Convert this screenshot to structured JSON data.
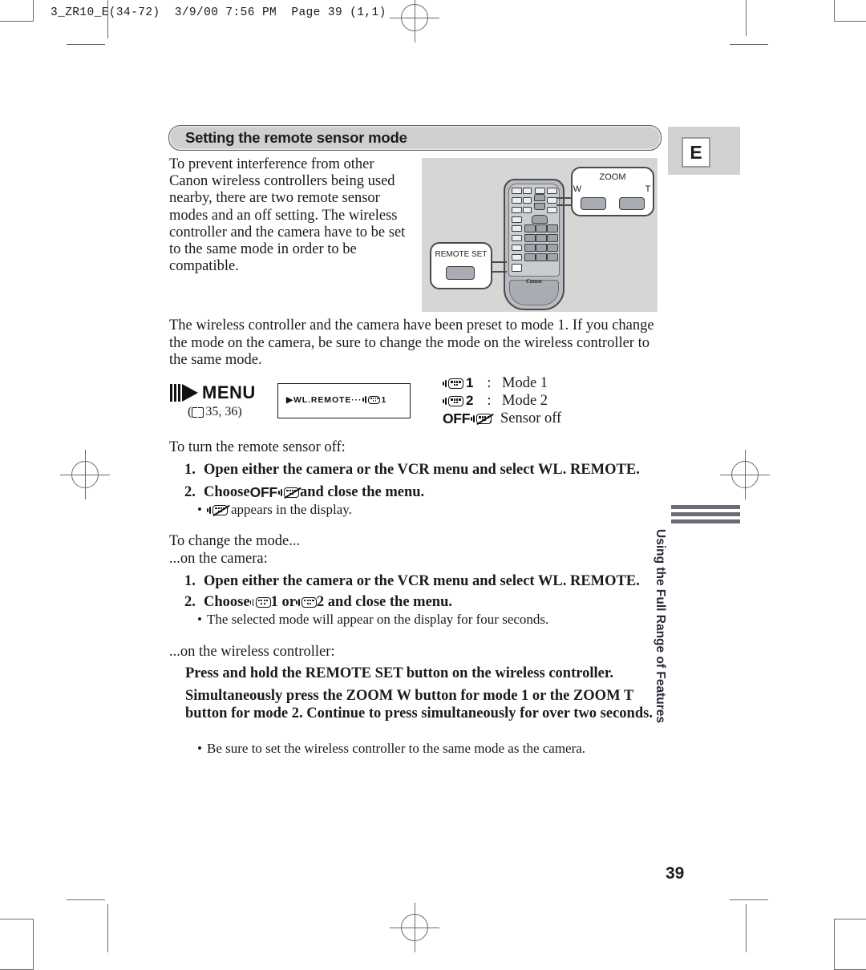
{
  "page": {
    "slug": "3_ZR10_E(34-72)  3/9/00 7:56 PM  Page 39 (1,1)",
    "number": "39",
    "lang_tab": "E"
  },
  "section": {
    "title": "Setting the remote sensor mode"
  },
  "intro": {
    "text": "To prevent interference from other Canon wireless controllers being used nearby, there are two remote sensor modes and an off setting. The wireless controller and the camera have to be set to the same mode in order to be compatible."
  },
  "illustration": {
    "zoom_callout_title": "ZOOM",
    "zoom_w_label": "W",
    "zoom_t_label": "T",
    "remote_set_label": "REMOTE SET",
    "brand": "Canon"
  },
  "preset_paragraph": {
    "text": "The wireless controller and the camera have been preset to mode 1. If you change the mode on the camera, be sure to change the mode on the wireless controller to the same mode."
  },
  "menu_block": {
    "label": "MENU",
    "reference": "35, 36)",
    "reference_open": "("
  },
  "lcd": {
    "text_before": "▶WL.REMOTE···",
    "text_after": "1"
  },
  "legend": {
    "rows": [
      {
        "icon": "remote-mode-icon",
        "value": "1",
        "colon": ":",
        "label": "Mode 1"
      },
      {
        "icon": "remote-mode-icon",
        "value": "2",
        "colon": ":",
        "label": "Mode 2"
      },
      {
        "icon": "remote-off-icon",
        "value": "OFF",
        "colon": ":",
        "label": "Sensor off"
      }
    ]
  },
  "turn_off": {
    "heading": "To turn the remote sensor off:",
    "step1_num": "1.",
    "step1_text": "Open either the camera or the VCR menu and select WL. REMOTE.",
    "step2_num": "2.",
    "step2_prefix": "Choose ",
    "step2_off": "OFF",
    "step2_suffix": " and close the menu.",
    "bullet_dot": "•",
    "bullet_text": "appears in the display."
  },
  "change_mode": {
    "heading": "To change the mode...",
    "subheading_camera": "...on the camera:",
    "step1_num": "1.",
    "step1_text": "Open either the camera or the VCR menu and select WL. REMOTE.",
    "step2_num": "2.",
    "step2_prefix": "Choose ",
    "step2_mid_1": " 1 or ",
    "step2_mid_2": " 2 and close the menu.",
    "bullet_dot": "•",
    "bullet_text": "The selected mode will appear on the display for four seconds.",
    "subheading_controller": "...on the wireless controller:"
  },
  "controller_steps": {
    "line1": "Press and hold the REMOTE SET button on the wireless controller.",
    "line2": "Simultaneously press the ZOOM W button for mode 1 or the ZOOM T button for mode 2. Continue to press simultaneously for over two seconds.",
    "bullet_dot": "•",
    "bullet_text": "Be sure to set the wireless controller to the same mode as the camera."
  },
  "side_tab": {
    "text": "Using the Full Range of Features"
  }
}
